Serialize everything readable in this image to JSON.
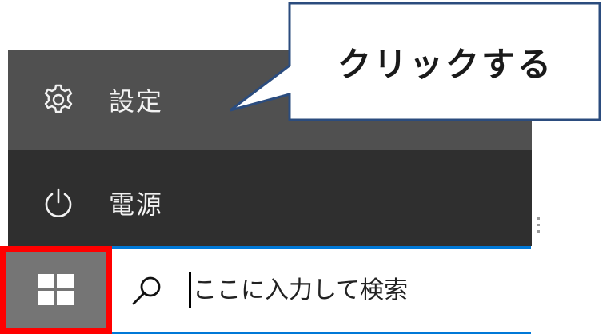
{
  "start_menu": {
    "items": [
      {
        "label": "設定",
        "icon": "gear-icon"
      },
      {
        "label": "電源",
        "icon": "power-icon"
      }
    ]
  },
  "taskbar": {
    "start_button_icon": "windows-logo-icon",
    "search": {
      "placeholder": "ここに入力して検索",
      "icon": "search-icon"
    }
  },
  "callout": {
    "text": "クリックする"
  },
  "colors": {
    "menu_background": "#2f2f2f",
    "menu_highlight": "#505050",
    "start_button": "#757575",
    "highlight_border": "#ff0000",
    "search_border": "#0078d7",
    "callout_border": "#2b4c7e"
  }
}
